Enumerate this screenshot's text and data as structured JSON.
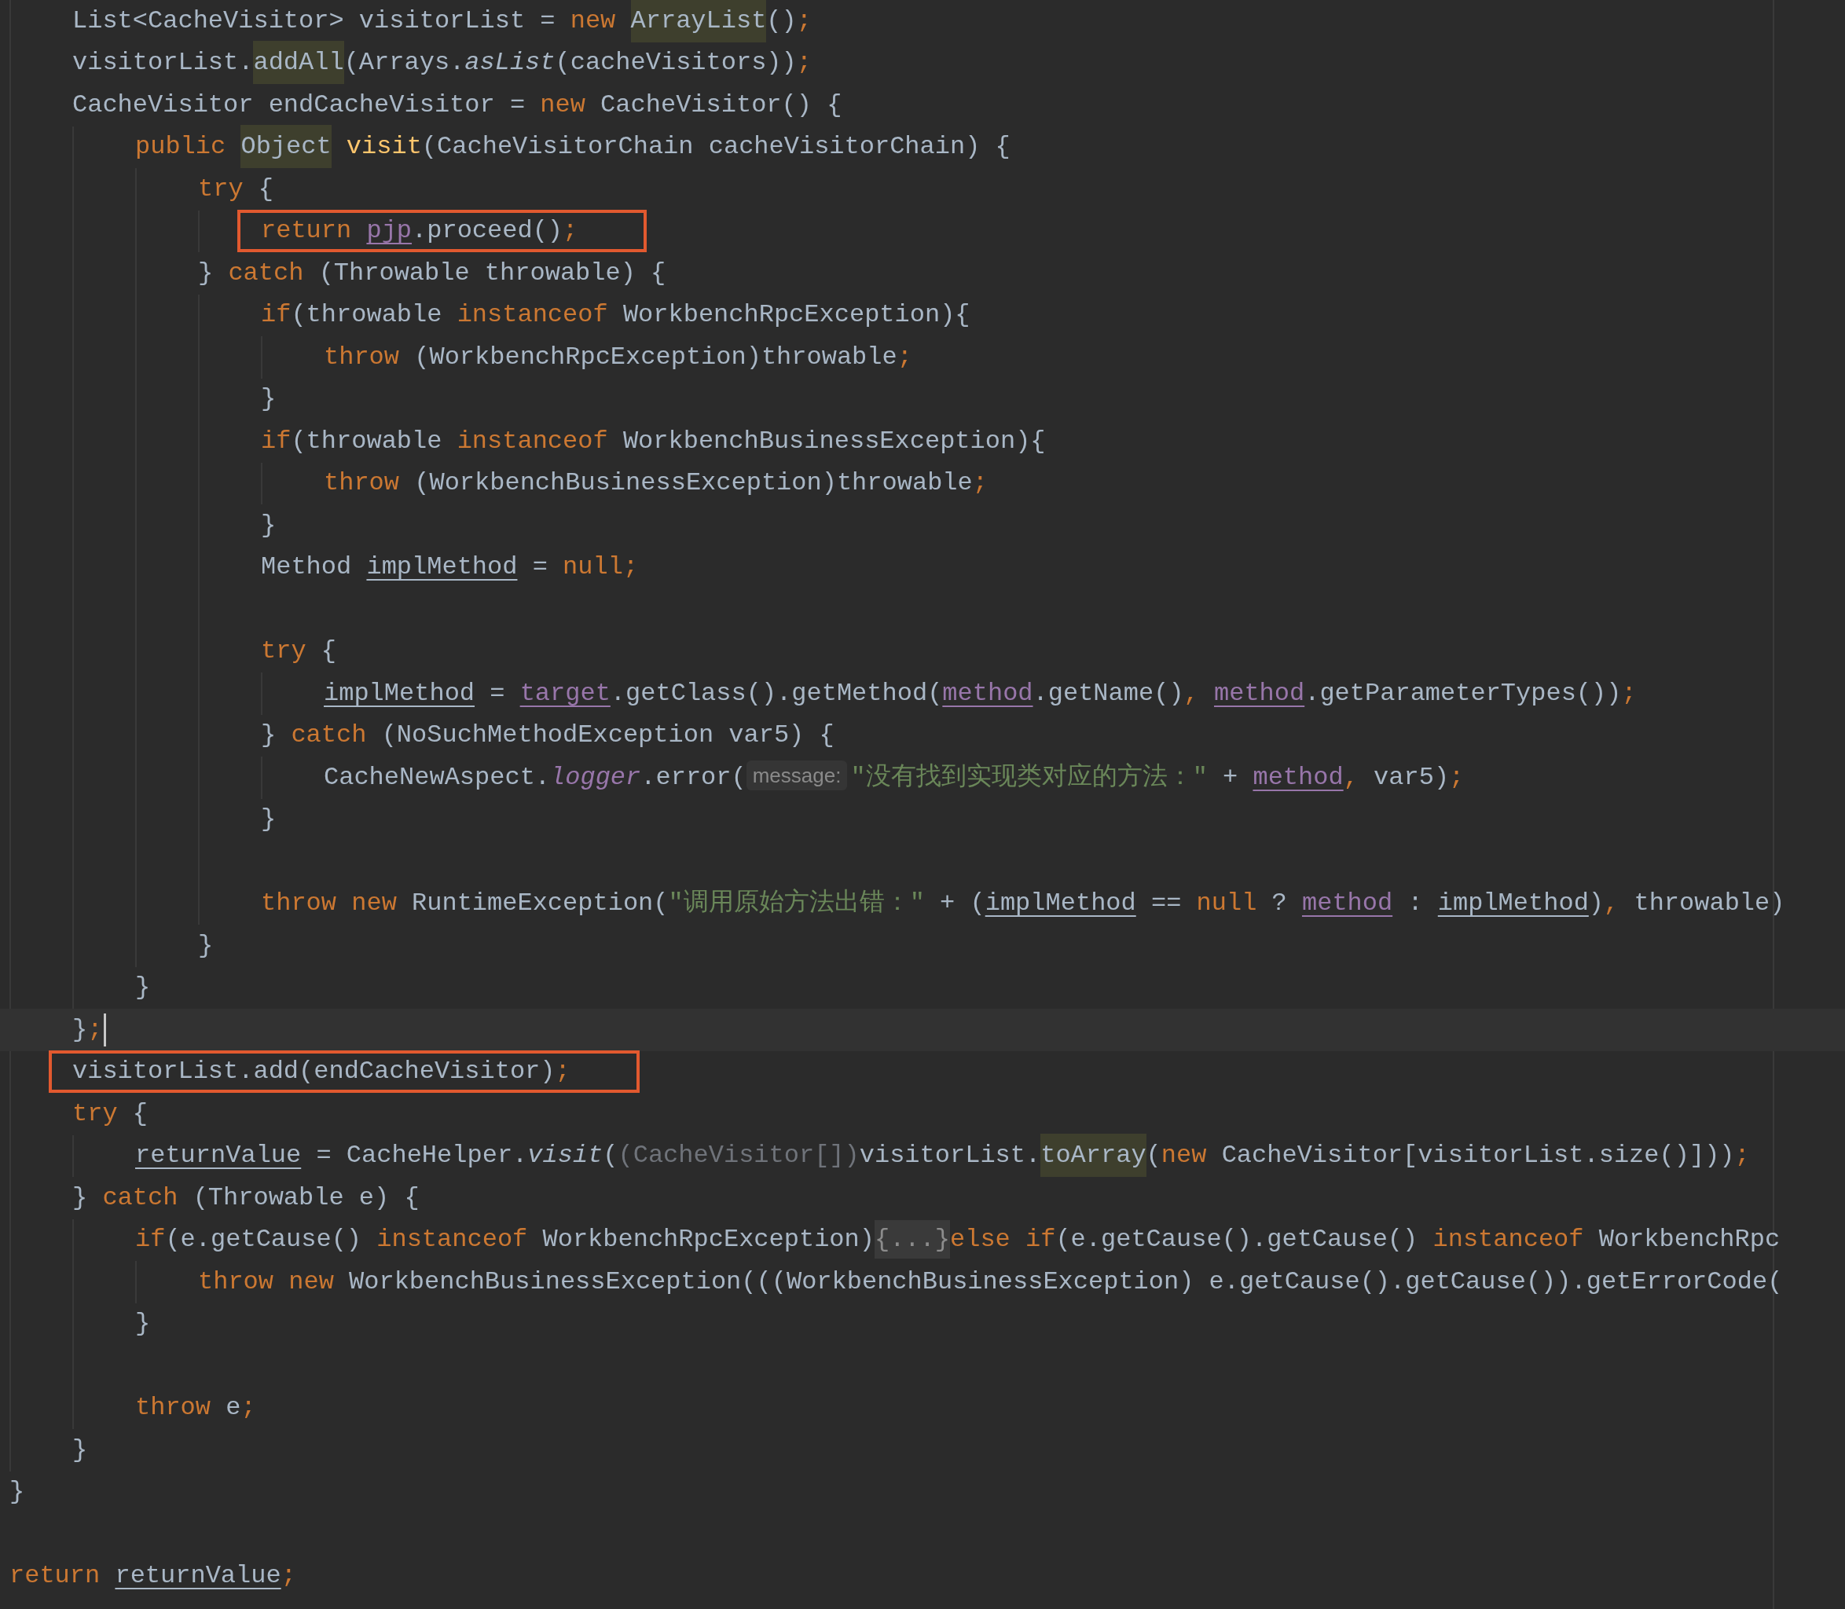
{
  "lines": [
    {
      "kind": "group",
      "children": [
        {
          "kind": "code",
          "tokens": [
            {
              "kind": "plain",
              "text": "List<CacheVisitor> visitorList = "
            },
            {
              "kind": "kw",
              "text": "new "
            },
            {
              "kind": "hl",
              "text": "ArrayList"
            },
            {
              "kind": "plain",
              "text": "()"
            },
            {
              "kind": "kw",
              "text": ";"
            }
          ]
        },
        {
          "kind": "code",
          "tokens": [
            {
              "kind": "plain",
              "text": "visitorList."
            },
            {
              "kind": "hl",
              "text": "addAll"
            },
            {
              "kind": "plain",
              "text": "(Arrays."
            },
            {
              "kind": "italic",
              "text": "asList"
            },
            {
              "kind": "plain",
              "text": "(cacheVisitors))"
            },
            {
              "kind": "kw",
              "text": ";"
            }
          ]
        },
        {
          "kind": "code",
          "tokens": [
            {
              "kind": "plain",
              "text": "CacheVisitor endCacheVisitor = "
            },
            {
              "kind": "kw",
              "text": "new"
            },
            {
              "kind": "plain",
              "text": " CacheVisitor() {"
            }
          ],
          "children": [
            {
              "kind": "code",
              "tokens": [
                {
                  "kind": "kw",
                  "text": "public "
                },
                {
                  "kind": "hl",
                  "text": "Object"
                },
                {
                  "kind": "decl",
                  "text": " visit"
                },
                {
                  "kind": "plain",
                  "text": "(CacheVisitorChain cacheVisitorChain) {"
                }
              ],
              "children": [
                {
                  "kind": "code",
                  "tokens": [
                    {
                      "kind": "kw",
                      "text": "try"
                    },
                    {
                      "kind": "plain",
                      "text": " {"
                    }
                  ],
                  "children": [
                    {
                      "kind": "code",
                      "boxed": true,
                      "tokens": [
                        {
                          "kind": "kw",
                          "text": "return "
                        },
                        {
                          "kind": "field",
                          "text": "pjp"
                        },
                        {
                          "kind": "plain",
                          "text": ".proceed()"
                        },
                        {
                          "kind": "kw",
                          "text": ";"
                        }
                      ]
                    }
                  ]
                },
                {
                  "kind": "code",
                  "tokens": [
                    {
                      "kind": "plain",
                      "text": "} "
                    },
                    {
                      "kind": "kw",
                      "text": "catch"
                    },
                    {
                      "kind": "plain",
                      "text": " (Throwable throwable) {"
                    }
                  ],
                  "children": [
                    {
                      "kind": "code",
                      "tokens": [
                        {
                          "kind": "kw",
                          "text": "if"
                        },
                        {
                          "kind": "plain",
                          "text": "(throwable "
                        },
                        {
                          "kind": "kw",
                          "text": "instanceof"
                        },
                        {
                          "kind": "plain",
                          "text": " WorkbenchRpcException){"
                        }
                      ],
                      "children": [
                        {
                          "kind": "code",
                          "tokens": [
                            {
                              "kind": "kw",
                              "text": "throw"
                            },
                            {
                              "kind": "plain",
                              "text": " (WorkbenchRpcException)throwable"
                            },
                            {
                              "kind": "kw",
                              "text": ";"
                            }
                          ]
                        }
                      ]
                    },
                    {
                      "kind": "code",
                      "tokens": [
                        {
                          "kind": "plain",
                          "text": "}"
                        }
                      ]
                    },
                    {
                      "kind": "code",
                      "tokens": [
                        {
                          "kind": "kw",
                          "text": "if"
                        },
                        {
                          "kind": "plain",
                          "text": "(throwable "
                        },
                        {
                          "kind": "kw",
                          "text": "instanceof"
                        },
                        {
                          "kind": "plain",
                          "text": " WorkbenchBusinessException){"
                        }
                      ],
                      "children": [
                        {
                          "kind": "code",
                          "tokens": [
                            {
                              "kind": "kw",
                              "text": "throw"
                            },
                            {
                              "kind": "plain",
                              "text": " (WorkbenchBusinessException)throwable"
                            },
                            {
                              "kind": "kw",
                              "text": ";"
                            }
                          ]
                        }
                      ]
                    },
                    {
                      "kind": "code",
                      "tokens": [
                        {
                          "kind": "plain",
                          "text": "}"
                        }
                      ]
                    },
                    {
                      "kind": "code",
                      "tokens": [
                        {
                          "kind": "plain",
                          "text": "Method "
                        },
                        {
                          "kind": "var",
                          "text": "implMethod"
                        },
                        {
                          "kind": "plain",
                          "text": " = "
                        },
                        {
                          "kind": "kw",
                          "text": "null;"
                        }
                      ]
                    },
                    {
                      "kind": "blank"
                    },
                    {
                      "kind": "code",
                      "tokens": [
                        {
                          "kind": "kw",
                          "text": "try"
                        },
                        {
                          "kind": "plain",
                          "text": " {"
                        }
                      ],
                      "children": [
                        {
                          "kind": "code",
                          "tokens": [
                            {
                              "kind": "var",
                              "text": "implMethod"
                            },
                            {
                              "kind": "plain",
                              "text": " = "
                            },
                            {
                              "kind": "field",
                              "text": "target"
                            },
                            {
                              "kind": "plain",
                              "text": ".getClass().getMethod("
                            },
                            {
                              "kind": "field",
                              "text": "method"
                            },
                            {
                              "kind": "plain",
                              "text": ".getName()"
                            },
                            {
                              "kind": "kw",
                              "text": ", "
                            },
                            {
                              "kind": "field",
                              "text": "method"
                            },
                            {
                              "kind": "plain",
                              "text": ".getParameterTypes())"
                            },
                            {
                              "kind": "kw",
                              "text": ";"
                            }
                          ]
                        }
                      ]
                    },
                    {
                      "kind": "code",
                      "tokens": [
                        {
                          "kind": "plain",
                          "text": "} "
                        },
                        {
                          "kind": "kw",
                          "text": "catch"
                        },
                        {
                          "kind": "plain",
                          "text": " (NoSuchMethodException var5) {"
                        }
                      ],
                      "children": [
                        {
                          "kind": "code",
                          "tokens": [
                            {
                              "kind": "plain",
                              "text": "CacheNewAspect."
                            },
                            {
                              "kind": "static",
                              "text": "logger"
                            },
                            {
                              "kind": "plain",
                              "text": ".error("
                            },
                            {
                              "kind": "hint",
                              "text": "message:"
                            },
                            {
                              "kind": "str",
                              "text": "\"没有找到实现类对应的方法：\""
                            },
                            {
                              "kind": "plain",
                              "text": " + "
                            },
                            {
                              "kind": "field",
                              "text": "method"
                            },
                            {
                              "kind": "kw",
                              "text": ","
                            },
                            {
                              "kind": "plain",
                              "text": " var5)"
                            },
                            {
                              "kind": "kw",
                              "text": ";"
                            }
                          ]
                        }
                      ]
                    },
                    {
                      "kind": "code",
                      "tokens": [
                        {
                          "kind": "plain",
                          "text": "}"
                        }
                      ]
                    },
                    {
                      "kind": "blank"
                    },
                    {
                      "kind": "code",
                      "tokens": [
                        {
                          "kind": "kw",
                          "text": "throw new"
                        },
                        {
                          "kind": "plain",
                          "text": " RuntimeException("
                        },
                        {
                          "kind": "str",
                          "text": "\"调用原始方法出错：\""
                        },
                        {
                          "kind": "plain",
                          "text": " + ("
                        },
                        {
                          "kind": "var",
                          "text": "implMethod"
                        },
                        {
                          "kind": "plain",
                          "text": " == "
                        },
                        {
                          "kind": "kw",
                          "text": "null"
                        },
                        {
                          "kind": "plain",
                          "text": " ? "
                        },
                        {
                          "kind": "field",
                          "text": "method"
                        },
                        {
                          "kind": "plain",
                          "text": " : "
                        },
                        {
                          "kind": "var",
                          "text": "implMethod"
                        },
                        {
                          "kind": "plain",
                          "text": ")"
                        },
                        {
                          "kind": "kw",
                          "text": ","
                        },
                        {
                          "kind": "plain",
                          "text": " throwable)"
                        }
                      ]
                    }
                  ]
                },
                {
                  "kind": "code",
                  "tokens": [
                    {
                      "kind": "plain",
                      "text": "}"
                    }
                  ]
                }
              ]
            },
            {
              "kind": "code",
              "tokens": [
                {
                  "kind": "plain",
                  "text": "}"
                }
              ]
            }
          ]
        },
        {
          "kind": "code",
          "current": true,
          "tokens": [
            {
              "kind": "plain",
              "text": "}"
            },
            {
              "kind": "kw",
              "text": ";"
            }
          ]
        },
        {
          "kind": "code",
          "boxed": true,
          "tokens": [
            {
              "kind": "plain",
              "text": "visitorList.add(endCacheVisitor)"
            },
            {
              "kind": "kw",
              "text": ";"
            }
          ]
        },
        {
          "kind": "code",
          "tokens": [
            {
              "kind": "kw",
              "text": "try"
            },
            {
              "kind": "plain",
              "text": " {"
            }
          ],
          "children": [
            {
              "kind": "code",
              "tokens": [
                {
                  "kind": "var",
                  "text": "returnValue"
                },
                {
                  "kind": "plain",
                  "text": " = CacheHelper."
                },
                {
                  "kind": "italic",
                  "text": "visit"
                },
                {
                  "kind": "plain",
                  "text": "("
                },
                {
                  "kind": "muted",
                  "text": "(CacheVisitor[])"
                },
                {
                  "kind": "plain",
                  "text": "visitorList."
                },
                {
                  "kind": "hl",
                  "text": "toArray"
                },
                {
                  "kind": "plain",
                  "text": "("
                },
                {
                  "kind": "kw",
                  "text": "new"
                },
                {
                  "kind": "plain",
                  "text": " CacheVisitor[visitorList.size()]))"
                },
                {
                  "kind": "kw",
                  "text": ";"
                }
              ]
            }
          ]
        },
        {
          "kind": "code",
          "tokens": [
            {
              "kind": "plain",
              "text": "} "
            },
            {
              "kind": "kw",
              "text": "catch"
            },
            {
              "kind": "plain",
              "text": " (Throwable e) {"
            }
          ],
          "children": [
            {
              "kind": "code",
              "tokens": [
                {
                  "kind": "kw",
                  "text": "if"
                },
                {
                  "kind": "plain",
                  "text": "(e.getCause() "
                },
                {
                  "kind": "kw",
                  "text": "instanceof"
                },
                {
                  "kind": "plain",
                  "text": " WorkbenchRpcException)"
                },
                {
                  "kind": "fold",
                  "text": "{...}"
                },
                {
                  "kind": "kw",
                  "text": "else if"
                },
                {
                  "kind": "plain",
                  "text": "(e.getCause().getCause() "
                },
                {
                  "kind": "kw",
                  "text": "instanceof"
                },
                {
                  "kind": "plain",
                  "text": " WorkbenchRpc"
                }
              ],
              "children": [
                {
                  "kind": "code",
                  "tokens": [
                    {
                      "kind": "kw",
                      "text": "throw new"
                    },
                    {
                      "kind": "plain",
                      "text": " WorkbenchBusinessException(((WorkbenchBusinessException) e.getCause().getCause()).getErrorCode("
                    }
                  ]
                }
              ]
            },
            {
              "kind": "code",
              "tokens": [
                {
                  "kind": "plain",
                  "text": "}"
                }
              ]
            },
            {
              "kind": "blank"
            },
            {
              "kind": "code",
              "tokens": [
                {
                  "kind": "kw",
                  "text": "throw"
                },
                {
                  "kind": "plain",
                  "text": " e"
                },
                {
                  "kind": "kw",
                  "text": ";"
                }
              ]
            }
          ]
        },
        {
          "kind": "code",
          "tokens": [
            {
              "kind": "plain",
              "text": "}"
            }
          ]
        }
      ]
    },
    {
      "kind": "code",
      "tokens": [
        {
          "kind": "plain",
          "text": "}"
        }
      ]
    },
    {
      "kind": "blank"
    },
    {
      "kind": "code",
      "tokens": [
        {
          "kind": "kw",
          "text": "return "
        },
        {
          "kind": "var",
          "text": "returnValue"
        },
        {
          "kind": "kw",
          "text": ";"
        }
      ]
    }
  ]
}
